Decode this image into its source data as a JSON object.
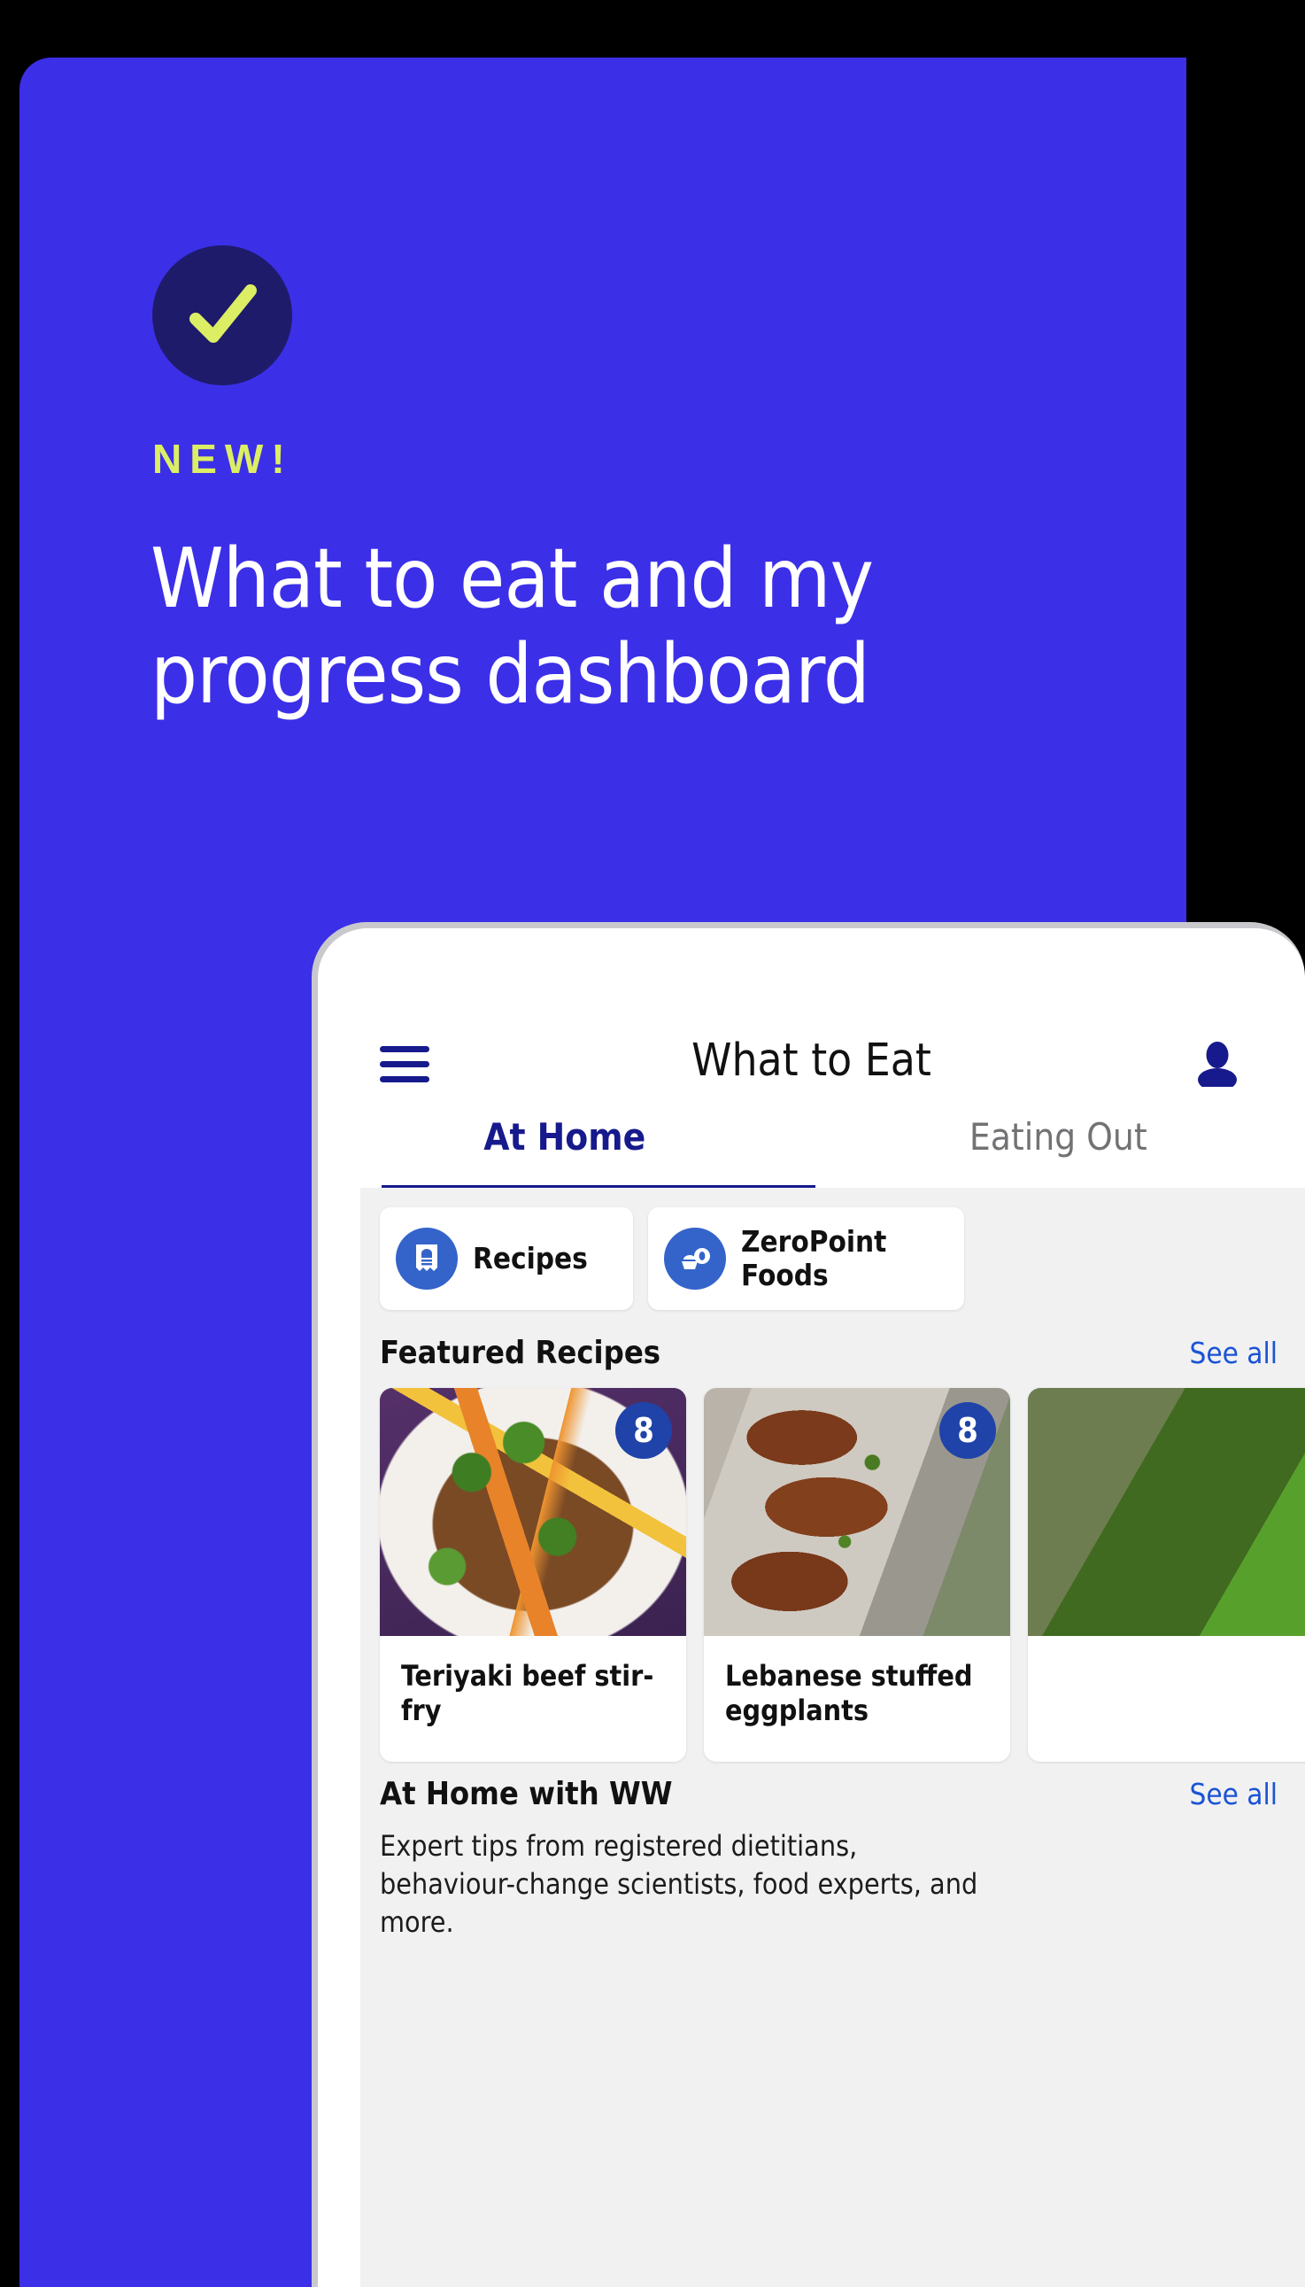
{
  "promo": {
    "badge_icon": "check-circle-icon",
    "eyebrow": "NEW!",
    "headline": "What to eat and my\nprogress dashboard",
    "colors": {
      "panel_blue": "#3C2FE8",
      "badge_navy": "#1E1B6B",
      "accent_lime": "#DCEE63",
      "headline_white": "#FFFFFF"
    }
  },
  "app": {
    "appbar": {
      "menu_icon": "hamburger-menu-icon",
      "title": "What to Eat",
      "profile_icon": "person-avatar-icon"
    },
    "tabs": [
      {
        "label": "At Home",
        "active": true
      },
      {
        "label": "Eating Out",
        "active": false
      }
    ],
    "quick_links": [
      {
        "label": "Recipes",
        "icon": "recipe-book-icon"
      },
      {
        "label": "ZeroPoint\nFoods",
        "icon": "zeropoint-bowl-icon"
      }
    ],
    "sections": [
      {
        "title": "Featured Recipes",
        "see_all": "See all",
        "recipes": [
          {
            "name": "Teriyaki beef stir-fry",
            "points": "8",
            "photo": "beef-stir-fry-photo"
          },
          {
            "name": "Lebanese stuffed eggplants",
            "points": "8",
            "photo": "stuffed-eggplants-photo"
          }
        ]
      },
      {
        "title": "At Home with WW",
        "see_all": "See all",
        "body": "Expert tips from registered dietitians, behaviour-change scientists, food experts, and more."
      }
    ],
    "colors": {
      "navy": "#161A8C",
      "link_blue": "#1B53D6",
      "icon_blue": "#3464CA",
      "point_badge_blue": "#1F43A8",
      "tab_inactive": "#727275",
      "content_bg": "#F1F1F1"
    }
  }
}
